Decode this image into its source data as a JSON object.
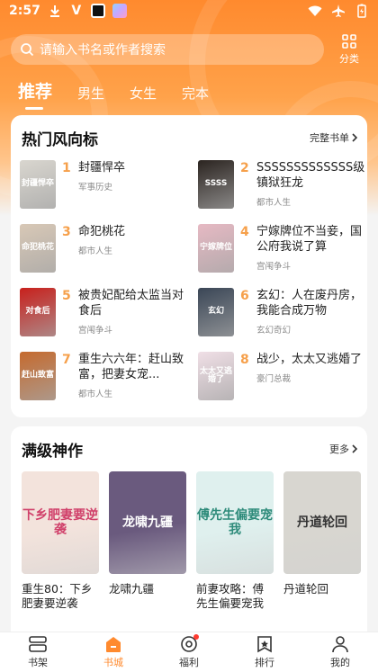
{
  "status_bar": {
    "time": "2:57"
  },
  "search": {
    "placeholder": "请输入书名或作者搜索",
    "category_label": "分类"
  },
  "tabs": [
    {
      "label": "推荐"
    },
    {
      "label": "男生"
    },
    {
      "label": "女生"
    },
    {
      "label": "完本"
    }
  ],
  "hot_section": {
    "title": "热门风向标",
    "more_label": "完整书单",
    "items": [
      {
        "rank": "1",
        "name": "封疆悍卒",
        "tag": "军事历史",
        "cover_text": "封疆悍卒",
        "cover_color": "#d9d6cf"
      },
      {
        "rank": "2",
        "name": "SSSSSSSSSSSSS级镇狱狂龙",
        "tag": "都市人生",
        "cover_text": "SSSS",
        "cover_color": "#2b2420"
      },
      {
        "rank": "3",
        "name": "命犯桃花",
        "tag": "都市人生",
        "cover_text": "命犯桃花",
        "cover_color": "#d8c8b6"
      },
      {
        "rank": "4",
        "name": "宁嫁牌位不当妾，国公府我说了算",
        "tag": "宫闱争斗",
        "cover_text": "宁嫁牌位",
        "cover_color": "#e6b9c3"
      },
      {
        "rank": "5",
        "name": "被贵妃配给太监当对食后",
        "tag": "宫闱争斗",
        "cover_text": "对食后",
        "cover_color": "#c8201c"
      },
      {
        "rank": "6",
        "name": "玄幻：人在废丹房，我能合成万物",
        "tag": "玄幻奇幻",
        "cover_text": "玄幻",
        "cover_color": "#3a4656"
      },
      {
        "rank": "7",
        "name": "重生六六年：赶山致富，把妻女宠...",
        "tag": "都市人生",
        "cover_text": "赶山致富",
        "cover_color": "#c56a2e"
      },
      {
        "rank": "8",
        "name": "战少，太太又逃婚了",
        "tag": "豪门总裁",
        "cover_text": "太太又逃婚了",
        "cover_color": "#f0dfe6"
      }
    ]
  },
  "top_section": {
    "title": "满级神作",
    "more_label": "更多",
    "books": [
      {
        "name": "重生80：下乡肥妻要逆袭",
        "cover_text": "下乡肥妻要逆袭",
        "cover_color": "#f3e3dc",
        "cover_fg": "#d0406a"
      },
      {
        "name": "龙啸九疆",
        "cover_text": "龙啸九疆",
        "cover_color": "#6a5a7e",
        "cover_fg": "#ffffff"
      },
      {
        "name": "前妻攻略：傅先生偏要宠我",
        "cover_text": "傅先生偏要宠我",
        "cover_color": "#dff0ee",
        "cover_fg": "#2e8b7a"
      },
      {
        "name": "丹道轮回",
        "cover_text": "丹道轮回",
        "cover_color": "#d8d6d0",
        "cover_fg": "#333333"
      }
    ]
  },
  "bottom_nav": [
    {
      "label": "书架",
      "icon": "bookshelf-icon"
    },
    {
      "label": "书城",
      "icon": "bookstore-icon",
      "active": true
    },
    {
      "label": "福利",
      "icon": "welfare-icon"
    },
    {
      "label": "排行",
      "icon": "ranking-icon"
    },
    {
      "label": "我的",
      "icon": "profile-icon"
    }
  ],
  "colors": {
    "accent": "#ff8a2e",
    "rank_number": "#f6a04b"
  }
}
